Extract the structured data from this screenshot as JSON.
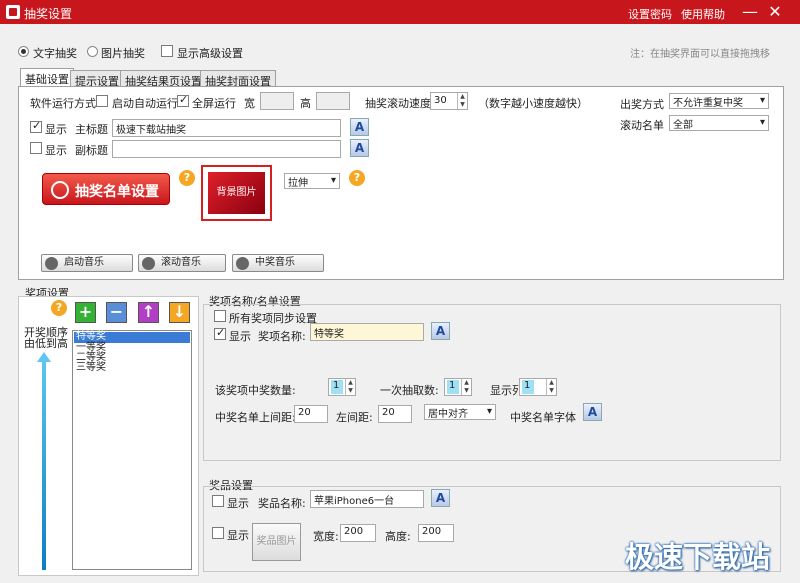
{
  "window": {
    "title": "抽奖设置",
    "links": [
      "设置密码",
      "使用帮助"
    ],
    "minimize": "—",
    "close": "✕"
  },
  "mode": {
    "text_draw": "文字抽奖",
    "image_draw": "图片抽奖",
    "advanced": "显示高级设置",
    "hint": "注：在抽奖界面可以直接拖拽移"
  },
  "tabs": [
    "基础设置",
    "提示设置",
    "抽奖结果页设置",
    "抽奖封面设置"
  ],
  "basic": {
    "run_mode_label": "软件运行方式",
    "autostart": "启动自动运行",
    "fullscreen": "全屏运行",
    "width_label": "宽",
    "height_label": "高",
    "speed_label": "抽奖滚动速度",
    "speed_value": "30",
    "speed_hint": "（数字越小速度越快）",
    "output_label": "出奖方式",
    "output_value": "不允许重复中奖",
    "scroll_label": "滚动名单",
    "scroll_value": "全部",
    "show1": "显示",
    "main_title_label": "主标题",
    "main_title_value": "极速下载站抽奖",
    "show2": "显示",
    "sub_title_label": "副标题",
    "sub_title_value": "",
    "list_btn": "抽奖名单设置",
    "bg_btn": "背景图片",
    "stretch_value": "拉伸",
    "music_start": "启动音乐",
    "music_scroll": "滚动音乐",
    "music_win": "中奖音乐",
    "font_btn": "A",
    "help": "?"
  },
  "prize": {
    "section_label": "奖项设置",
    "order_text": "开奖顺序\n由低到高",
    "list": [
      "特等奖",
      "一等奖",
      "二等奖",
      "三等奖"
    ],
    "add": "+",
    "remove": "−",
    "up": "↑",
    "down": "↓"
  },
  "prize_name": {
    "section_label": "奖项名称/名单设置",
    "sync": "所有奖项同步设置",
    "show": "显示",
    "name_label": "奖项名称:",
    "name_value": "特等奖",
    "winners_label": "该奖项中奖数量:",
    "winners_value": "1",
    "per_draw_label": "一次抽取数:",
    "per_draw_value": "1",
    "columns_label": "显示列数:",
    "columns_value": "1",
    "top_margin_label": "中奖名单上间距:",
    "top_margin_value": "20",
    "left_margin_label": "左间距:",
    "left_margin_value": "20",
    "align_value": "居中对齐",
    "font_label": "中奖名单字体"
  },
  "gift": {
    "section_label": "奖品设置",
    "show1": "显示",
    "name_label": "奖品名称:",
    "name_value": "苹果iPhone6一台",
    "show2": "显示",
    "img_btn": "奖品图片",
    "width_label": "宽度:",
    "width_value": "200",
    "height_label": "高度:",
    "height_value": "200"
  },
  "watermark": "极速下载站"
}
